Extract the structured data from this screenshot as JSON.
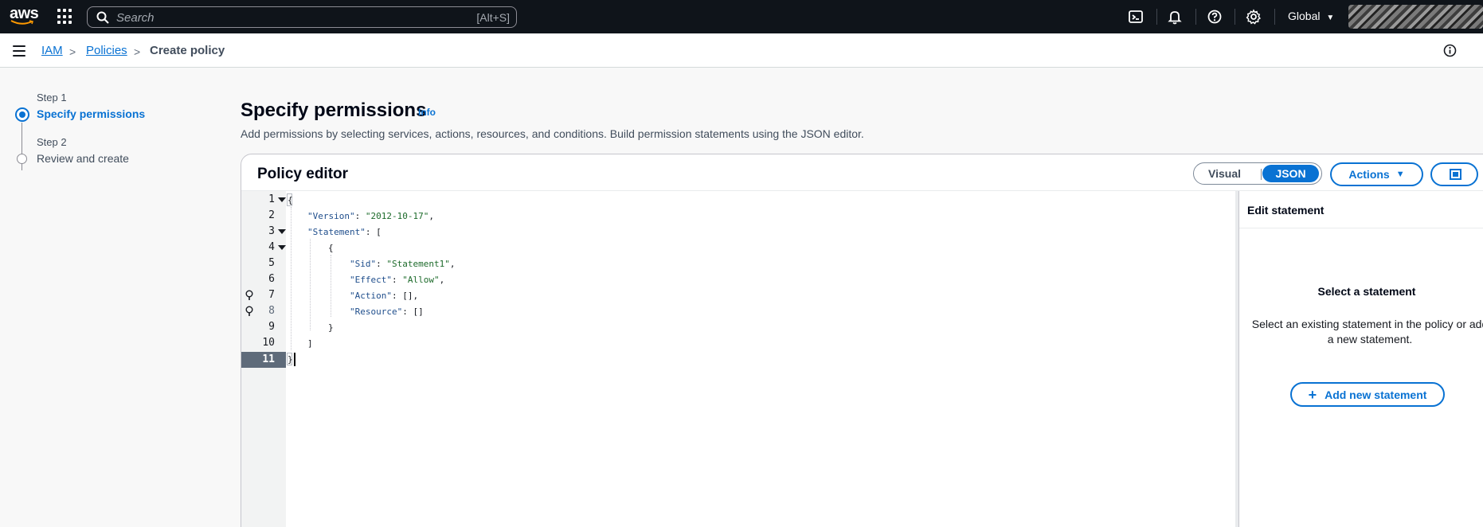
{
  "topnav": {
    "logo_text": "aws",
    "search_placeholder": "Search",
    "search_shortcut": "[Alt+S]",
    "region": "Global",
    "icons": [
      "apps-grid-icon",
      "search-icon",
      "cloudshell-icon",
      "bell-icon",
      "help-icon",
      "gear-icon"
    ]
  },
  "breadcrumb": {
    "items": [
      "IAM",
      "Policies",
      "Create policy"
    ]
  },
  "wizard": {
    "steps": [
      {
        "label": "Step 1",
        "title": "Specify permissions",
        "state": "active"
      },
      {
        "label": "Step 2",
        "title": "Review and create",
        "state": "inactive"
      }
    ]
  },
  "page": {
    "title": "Specify permissions",
    "info": "Info",
    "description": "Add permissions by selecting services, actions, resources, and conditions. Build permission statements using the JSON editor."
  },
  "editor": {
    "title": "Policy editor",
    "mode_visual": "Visual",
    "mode_json": "JSON",
    "selected_mode": "JSON",
    "actions_label": "Actions",
    "line_numbers": [
      "1",
      "2",
      "3",
      "4",
      "5",
      "6",
      "7",
      "8",
      "9",
      "10",
      "11"
    ],
    "active_line": "11",
    "code": {
      "l1": "{",
      "l2_key": "\"Version\"",
      "l2_val": "\"2012-10-17\"",
      "l3_key": "\"Statement\"",
      "l3_rest": ": [",
      "l4": "{",
      "l5_key": "\"Sid\"",
      "l5_val": "\"Statement1\"",
      "l6_key": "\"Effect\"",
      "l6_val": "\"Allow\"",
      "l7_key": "\"Action\"",
      "l7_rest": ": [],",
      "l8_key": "\"Resource\"",
      "l8_rest": ": []",
      "l9": "}",
      "l10": "]",
      "l11": "}"
    }
  },
  "side_panel": {
    "heading": "Edit statement",
    "empty_title": "Select a statement",
    "empty_desc": "Select an existing statement in the policy or add a new statement.",
    "add_label": "Add new statement"
  },
  "colors": {
    "accent": "#0972d3",
    "topnav_bg": "#0f141a",
    "active_line_bg": "#5f6b7a"
  }
}
